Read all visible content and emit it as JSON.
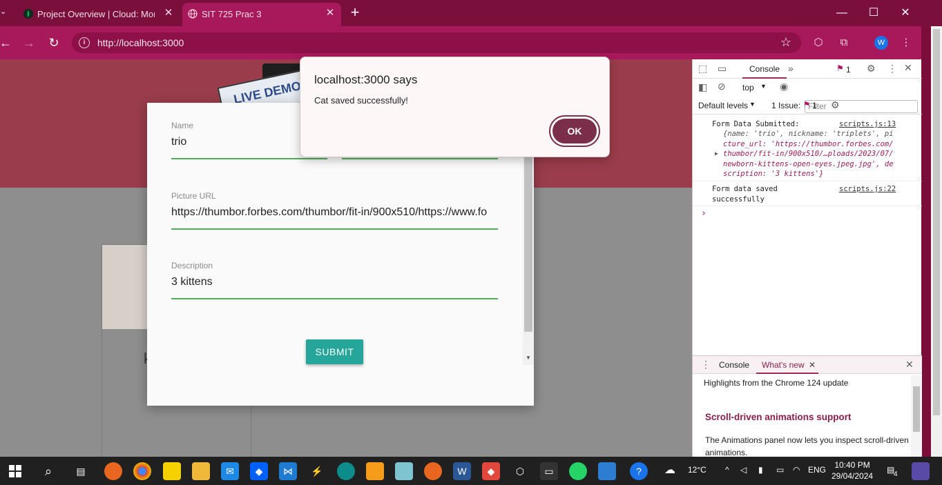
{
  "browser": {
    "tabs": [
      {
        "title": "Project Overview | Cloud: Mong",
        "close": "✕"
      },
      {
        "title": "SIT 725 Prac 3",
        "close": "✕"
      }
    ],
    "new_tab": "+",
    "url": "http://localhost:3000"
  },
  "page": {
    "demo_sign": "LIVE DEMO",
    "card_text": "k",
    "form": {
      "name_label": "Name",
      "name_value": "trio",
      "picture_label": "Picture URL",
      "picture_value": "https://thumbor.forbes.com/thumbor/fit-in/900x510/https://www.fo",
      "description_label": "Description",
      "description_value": "3 kittens",
      "submit_label": "SUBMIT"
    }
  },
  "alert": {
    "title": "localhost:3000 says",
    "message": "Cat saved successfully!",
    "ok_label": "OK"
  },
  "devtools": {
    "console_tab": "Console",
    "issues_badge": "1",
    "context": "top",
    "filter_placeholder": "Filter",
    "default_levels": "Default levels",
    "issue_label": "1 Issue:",
    "issue_count": "1",
    "logs": [
      {
        "text": "Form Data Submitted:",
        "source": "scripts.js:13"
      },
      {
        "text": "Form data saved",
        "text2": "successfully",
        "source": "scripts.js:22"
      }
    ],
    "object_lines": [
      "{name: 'trio', nickname: 'triplets', pi",
      "cture_url: 'https://thumbor.forbes.com/",
      "thumbor/fit-in/900x510/…ploads/2023/07/",
      "newborn-kittens-open-eyes.jpeg.jpg', de",
      "scription: '3 kittens'}"
    ],
    "prompt": "›",
    "drawer": {
      "console_tab": "Console",
      "whats_new_tab": "What's new",
      "highlights": "Highlights from the Chrome 124 update",
      "feature_title": "Scroll-driven animations support",
      "feature_text": "The Animations panel now lets you inspect scroll-driven animations."
    }
  },
  "taskbar": {
    "weather": "12°C",
    "language": "ENG",
    "time": "10:40 PM",
    "date": "29/04/2024",
    "notification_count": "4"
  }
}
